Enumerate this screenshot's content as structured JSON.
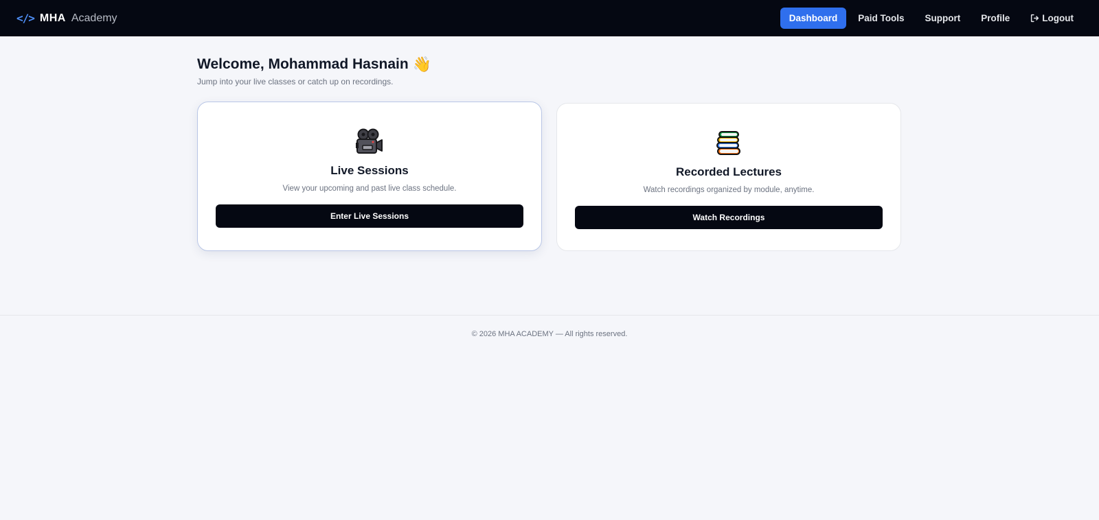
{
  "brand": {
    "code_glyph": "</>",
    "name_strong": "MHA",
    "name_light": "Academy",
    "accent": "#4f8ff7"
  },
  "nav": {
    "items": [
      {
        "label": "Dashboard",
        "active": true
      },
      {
        "label": "Paid Tools",
        "active": false
      },
      {
        "label": "Support",
        "active": false
      },
      {
        "label": "Profile",
        "active": false
      },
      {
        "label": "Logout",
        "active": false,
        "icon": "logout-icon"
      }
    ],
    "active_color": "#2f6fed"
  },
  "welcome": {
    "title": "Welcome, Mohammad Hasnain",
    "emoji": "👋",
    "subtitle": "Jump into your live classes or catch up on recordings."
  },
  "cards": [
    {
      "icon": "movie-camera-icon",
      "title": "Live Sessions",
      "description": "View your upcoming and past live class schedule.",
      "button_label": "Enter Live Sessions"
    },
    {
      "icon": "books-icon",
      "title": "Recorded Lectures",
      "description": "Watch recordings organized by module, anytime.",
      "button_label": "Watch Recordings"
    }
  ],
  "footer": {
    "text": "© 2026 MHA ACADEMY — All rights reserved."
  }
}
